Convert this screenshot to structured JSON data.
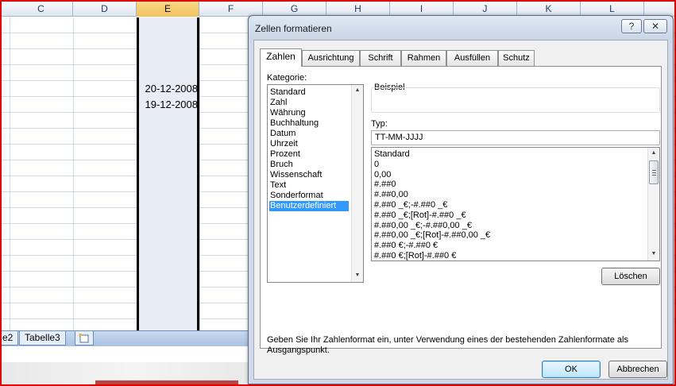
{
  "spreadsheet": {
    "columns": [
      {
        "label": "C",
        "selected": false
      },
      {
        "label": "D",
        "selected": false
      },
      {
        "label": "E",
        "selected": true
      },
      {
        "label": "F",
        "selected": false
      },
      {
        "label": "G",
        "selected": false
      },
      {
        "label": "H",
        "selected": false
      },
      {
        "label": "I",
        "selected": false
      },
      {
        "label": "J",
        "selected": false
      },
      {
        "label": "K",
        "selected": false
      },
      {
        "label": "L",
        "selected": false
      }
    ],
    "cells": [
      {
        "column": "E",
        "value": "20-12-2008"
      },
      {
        "column": "E",
        "value": "19-12-2008"
      }
    ],
    "sheet_tabs": [
      "e2",
      "Tabelle3"
    ],
    "insert_tab_icon": "insert-sheet-icon"
  },
  "dialog": {
    "title": "Zellen formatieren",
    "help_button": "?",
    "close_button": "✕",
    "tabs": [
      "Zahlen",
      "Ausrichtung",
      "Schrift",
      "Rahmen",
      "Ausfüllen",
      "Schutz"
    ],
    "active_tab": "Zahlen",
    "category_label": "Kategorie:",
    "categories": [
      "Standard",
      "Zahl",
      "Währung",
      "Buchhaltung",
      "Datum",
      "Uhrzeit",
      "Prozent",
      "Bruch",
      "Wissenschaft",
      "Text",
      "Sonderformat",
      "Benutzerdefiniert"
    ],
    "selected_category": "Benutzerdefiniert",
    "sample_label": "Beispiel",
    "type_label": "Typ:",
    "type_value": "TT-MM-JJJJ",
    "formats": [
      "Standard",
      "0",
      "0,00",
      "#.##0",
      "#.##0,00",
      "#.##0 _€;-#.##0 _€",
      "#.##0 _€;[Rot]-#.##0 _€",
      "#.##0,00 _€;-#.##0,00 _€",
      "#.##0,00 _€;[Rot]-#.##0,00 _€",
      "#.##0 €;-#.##0 €",
      "#.##0 €;[Rot]-#.##0 €"
    ],
    "delete_button": "Löschen",
    "hint_text": "Geben Sie Ihr Zahlenformat ein, unter Verwendung eines der bestehenden Zahlenformate als Ausgangspunkt.",
    "ok_button": "OK",
    "cancel_button": "Abbrechen"
  },
  "colors": {
    "frame": "#e00000",
    "selection": "#3399ff",
    "selected_column_header": "#f1c15f"
  }
}
